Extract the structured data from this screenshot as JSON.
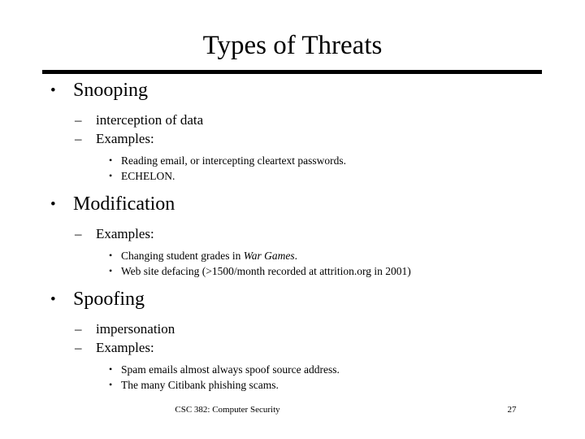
{
  "slide": {
    "title": "Types of Threats",
    "bullet_marks": {
      "level1": "•",
      "level2": "–",
      "level3": "•"
    },
    "sections": [
      {
        "heading": "Snooping",
        "sub": [
          {
            "text": "interception of data"
          },
          {
            "text": "Examples:"
          }
        ],
        "examples": [
          "Reading email, or intercepting cleartext passwords.",
          "ECHELON."
        ]
      },
      {
        "heading": "Modification",
        "sub": [
          {
            "text": "Examples:"
          }
        ],
        "examples_rich": [
          {
            "pre": "Changing student grades in ",
            "italic": "War Games",
            "post": "."
          },
          {
            "pre": "Web site defacing (>1500/month recorded at attrition.org in 2001)",
            "italic": "",
            "post": ""
          }
        ]
      },
      {
        "heading": "Spoofing",
        "sub": [
          {
            "text": "impersonation"
          },
          {
            "text": "Examples:"
          }
        ],
        "examples": [
          "Spam emails almost always spoof source address.",
          "The many Citibank phishing scams."
        ]
      }
    ],
    "footer": {
      "course": "CSC 382: Computer Security",
      "page_number": "27"
    },
    "colors": {
      "background": "#ffffff",
      "text": "#000000",
      "rule": "#000000"
    }
  }
}
